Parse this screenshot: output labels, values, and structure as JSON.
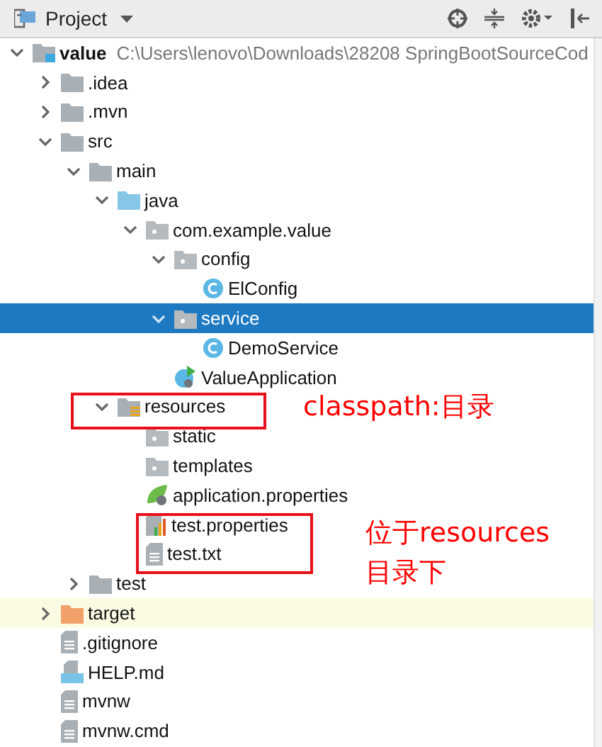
{
  "toolbar": {
    "title": "Project"
  },
  "tree": [
    {
      "name": "value",
      "detail": "C:\\Users\\lenovo\\Downloads\\28208 SpringBootSourceCod",
      "kind": "module",
      "expanded": true,
      "selected": false,
      "highlighted": false,
      "children": [
        {
          "name": ".idea",
          "kind": "folder",
          "expanded": false,
          "selected": false,
          "highlighted": false
        },
        {
          "name": ".mvn",
          "kind": "folder",
          "expanded": false,
          "selected": false,
          "highlighted": false
        },
        {
          "name": "src",
          "kind": "folder",
          "expanded": true,
          "selected": false,
          "highlighted": false,
          "children": [
            {
              "name": "main",
              "kind": "folder",
              "expanded": true,
              "selected": false,
              "highlighted": false,
              "children": [
                {
                  "name": "java",
                  "kind": "source",
                  "expanded": true,
                  "selected": false,
                  "highlighted": false,
                  "children": [
                    {
                      "name": "com.example.value",
                      "kind": "package",
                      "expanded": true,
                      "selected": false,
                      "highlighted": false,
                      "children": [
                        {
                          "name": "config",
                          "kind": "package",
                          "expanded": true,
                          "selected": false,
                          "highlighted": false,
                          "children": [
                            {
                              "name": "ElConfig",
                              "kind": "class",
                              "selected": false,
                              "highlighted": false
                            }
                          ]
                        },
                        {
                          "name": "service",
                          "kind": "package",
                          "expanded": true,
                          "selected": true,
                          "highlighted": false,
                          "children": [
                            {
                              "name": "DemoService",
                              "kind": "class",
                              "selected": false,
                              "highlighted": false
                            }
                          ]
                        },
                        {
                          "name": "ValueApplication",
                          "kind": "app",
                          "selected": false,
                          "highlighted": false
                        }
                      ]
                    }
                  ]
                },
                {
                  "name": "resources",
                  "kind": "resources",
                  "expanded": true,
                  "selected": false,
                  "highlighted": false,
                  "children": [
                    {
                      "name": "static",
                      "kind": "package",
                      "selected": false,
                      "highlighted": false
                    },
                    {
                      "name": "templates",
                      "kind": "package",
                      "selected": false,
                      "highlighted": false
                    },
                    {
                      "name": "application.properties",
                      "kind": "spring",
                      "selected": false,
                      "highlighted": false
                    },
                    {
                      "name": "test.properties",
                      "kind": "properties",
                      "selected": false,
                      "highlighted": false
                    },
                    {
                      "name": "test.txt",
                      "kind": "text",
                      "selected": false,
                      "highlighted": false
                    }
                  ]
                }
              ]
            },
            {
              "name": "test",
              "kind": "folder",
              "expanded": false,
              "selected": false,
              "highlighted": false
            }
          ]
        },
        {
          "name": "target",
          "kind": "excluded",
          "expanded": false,
          "selected": false,
          "highlighted": true
        },
        {
          "name": ".gitignore",
          "kind": "text",
          "selected": false,
          "highlighted": false
        },
        {
          "name": "HELP.md",
          "kind": "markdown",
          "selected": false,
          "highlighted": false
        },
        {
          "name": "mvnw",
          "kind": "text",
          "selected": false,
          "highlighted": false
        },
        {
          "name": "mvnw.cmd",
          "kind": "text",
          "selected": false,
          "highlighted": false
        }
      ]
    }
  ],
  "annotations": [
    {
      "text": "classpath:目录"
    },
    {
      "text": "位于resources目录下"
    }
  ]
}
